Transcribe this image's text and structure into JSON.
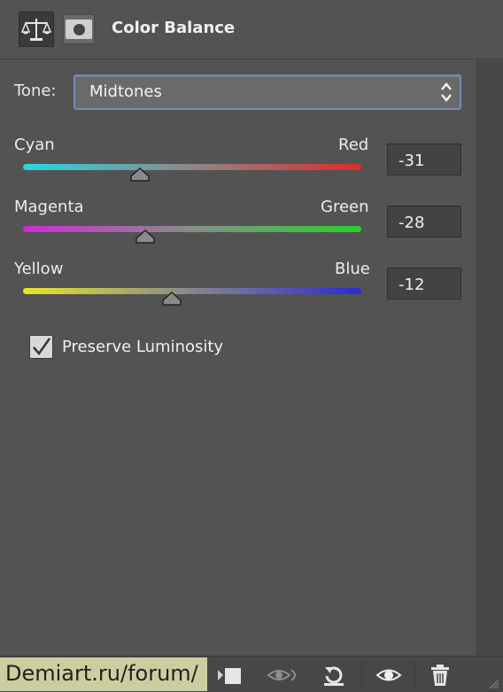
{
  "header": {
    "title": "Color Balance"
  },
  "tone": {
    "label": "Tone:",
    "value": "Midtones"
  },
  "sliders": [
    {
      "left_label": "Cyan",
      "right_label": "Red",
      "value": "-31",
      "level": -31
    },
    {
      "left_label": "Magenta",
      "right_label": "Green",
      "value": "-28",
      "level": -28
    },
    {
      "left_label": "Yellow",
      "right_label": "Blue",
      "value": "-12",
      "level": -12
    }
  ],
  "preserve": {
    "label": "Preserve Luminosity",
    "checked": true
  },
  "watermark": {
    "text": "Demiart.ru/forum/"
  },
  "footer_icons": [
    "clip-to-layer-icon",
    "view-previous-icon",
    "reset-icon",
    "visibility-eye-icon",
    "trash-icon"
  ],
  "colors": {
    "panel": "#535353",
    "focus_border": "#6f8db8",
    "value_box": "#434343"
  }
}
